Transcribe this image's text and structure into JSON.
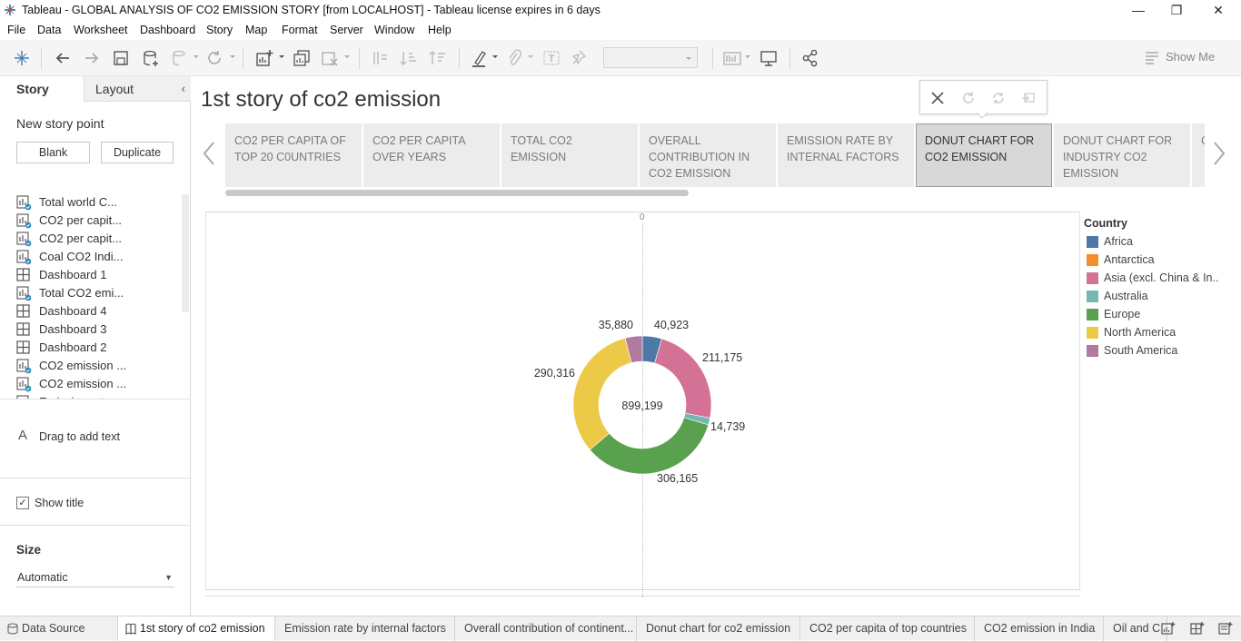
{
  "window": {
    "title": "Tableau - GLOBAL ANALYSIS OF CO2 EMISSION STORY [from LOCALHOST] - Tableau license expires in 6 days",
    "minimize": "—",
    "restore": "❐",
    "close": "✕"
  },
  "menu": [
    "File",
    "Data",
    "Worksheet",
    "Dashboard",
    "Story",
    "Map",
    "Format",
    "Server",
    "Window",
    "Help"
  ],
  "toolbar": {
    "show_me": "Show Me"
  },
  "left_pane": {
    "tabs": {
      "story": "Story",
      "layout": "Layout"
    },
    "collapse": "‹",
    "new_story_point": "New story point",
    "blank": "Blank",
    "duplicate": "Duplicate",
    "sheets": [
      {
        "label": "Total world C...",
        "type": "worksheet"
      },
      {
        "label": "CO2 per capit...",
        "type": "worksheet"
      },
      {
        "label": "CO2 per capit...",
        "type": "worksheet"
      },
      {
        "label": "Coal CO2 Indi...",
        "type": "worksheet"
      },
      {
        "label": "Dashboard 1",
        "type": "dashboard"
      },
      {
        "label": "Total CO2 emi...",
        "type": "worksheet"
      },
      {
        "label": "Dashboard 4",
        "type": "dashboard"
      },
      {
        "label": "Dashboard 3",
        "type": "dashboard"
      },
      {
        "label": "Dashboard 2",
        "type": "dashboard"
      },
      {
        "label": "CO2 emission ...",
        "type": "worksheet"
      },
      {
        "label": "CO2 emission ...",
        "type": "worksheet"
      },
      {
        "label": "Emission rat...",
        "type": "worksheet"
      }
    ],
    "drag_text_icon": "A",
    "drag_text": "Drag to add text",
    "show_title": "Show title",
    "show_title_checked": "✓",
    "size_label": "Size",
    "size_value": "Automatic",
    "size_caret": "▼"
  },
  "story": {
    "title": "1st story of co2 emission",
    "points": [
      "CO2 PER CAPITA OF TOP 20 C0UNTRIES",
      "CO2 PER CAPITA OVER YEARS",
      "TOTAL CO2 EMISSION",
      "OVERALL CONTRIBUTION IN CO2 EMISSION",
      "EMISSION RATE BY INTERNAL FACTORS",
      "DONUT CHART FOR CO2 EMISSION",
      "DONUT CHART FOR INDUSTRY CO2 EMISSION",
      "C... C... C..."
    ],
    "active_index": 5
  },
  "viz": {
    "axis_zero": "0",
    "total_label": "899,199",
    "legend_title": "Country"
  },
  "chart_data": {
    "type": "pie",
    "donut": true,
    "center_label": "899,199",
    "legend_title": "Country",
    "legend_placement": "right",
    "categories": [
      "Africa",
      "Antarctica",
      "Asia (excl. China & In..",
      "Australia",
      "Europe",
      "North America",
      "South America"
    ],
    "slices": [
      {
        "name": "Africa",
        "value": 40923,
        "label": "40,923",
        "color": "#4e79a7"
      },
      {
        "name": "Antarctica",
        "value": 0,
        "label": "",
        "color": "#f28e2b"
      },
      {
        "name": "Asia (excl. China & In..",
        "value": 211175,
        "label": "211,175",
        "color": "#d37295"
      },
      {
        "name": "Australia",
        "value": 14739,
        "label": "14,739",
        "color": "#76b7b2"
      },
      {
        "name": "Europe",
        "value": 306165,
        "label": "306,165",
        "color": "#59a14f"
      },
      {
        "name": "North America",
        "value": 290316,
        "label": "290,316",
        "color": "#edc948"
      },
      {
        "name": "South America",
        "value": 35880,
        "label": "35,880",
        "color": "#b07aa1"
      }
    ]
  },
  "bottom_tabs": [
    {
      "label": "Data Source",
      "icon": "database-icon"
    },
    {
      "label": "1st story of co2 emission",
      "icon": "story-icon",
      "active": true
    },
    {
      "label": "Emission rate by internal factors"
    },
    {
      "label": "Overall contribution of continent..."
    },
    {
      "label": "Donut chart for co2 emission"
    },
    {
      "label": "CO2 per capita of top countries"
    },
    {
      "label": "CO2 emission in India"
    },
    {
      "label": "Oil and C"
    }
  ]
}
